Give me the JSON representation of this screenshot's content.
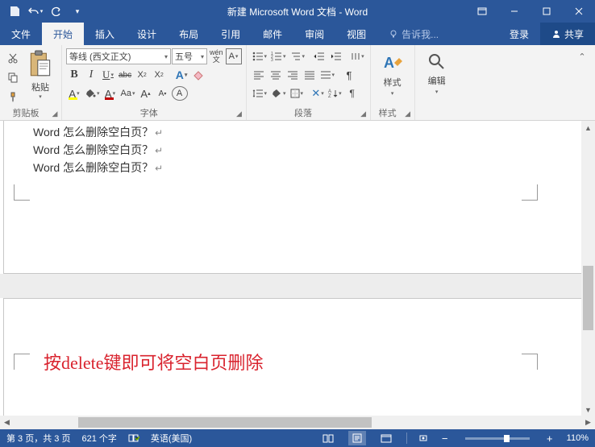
{
  "title": "新建 Microsoft Word 文档 - Word",
  "qat": {
    "save": "保存",
    "undo": "撤销",
    "redo": "重做"
  },
  "tabs": {
    "file": "文件",
    "home": "开始",
    "insert": "插入",
    "design": "设计",
    "layout": "布局",
    "references": "引用",
    "mailings": "邮件",
    "review": "审阅",
    "view": "视图",
    "tell_me": "告诉我...",
    "login": "登录",
    "share": "共享"
  },
  "ribbon": {
    "clipboard": {
      "label": "剪贴板",
      "paste": "粘贴"
    },
    "font": {
      "label": "字体",
      "name": "等线 (西文正文)",
      "size": "五号",
      "phonetic": "wén",
      "bold": "B",
      "italic": "I",
      "underline": "U",
      "strike": "abc",
      "subscript": "X₂",
      "superscript": "X²",
      "clear_format": "A",
      "highlight": "A",
      "font_color": "A",
      "case": "Aa",
      "grow": "A",
      "shrink": "A",
      "char_border": "A"
    },
    "paragraph": {
      "label": "段落"
    },
    "styles": {
      "label": "样式",
      "button": "样式"
    },
    "editing": {
      "label": "编辑",
      "button": "编辑"
    }
  },
  "document": {
    "lines": [
      "Word 怎么删除空白页？",
      "Word 怎么删除空白页？",
      "Word 怎么删除空白页？"
    ],
    "annotation": "按delete键即可将空白页删除"
  },
  "status": {
    "page": "第 3 页，共 3 页",
    "words": "621 个字",
    "language": "英语(美国)",
    "zoom": "110%"
  }
}
